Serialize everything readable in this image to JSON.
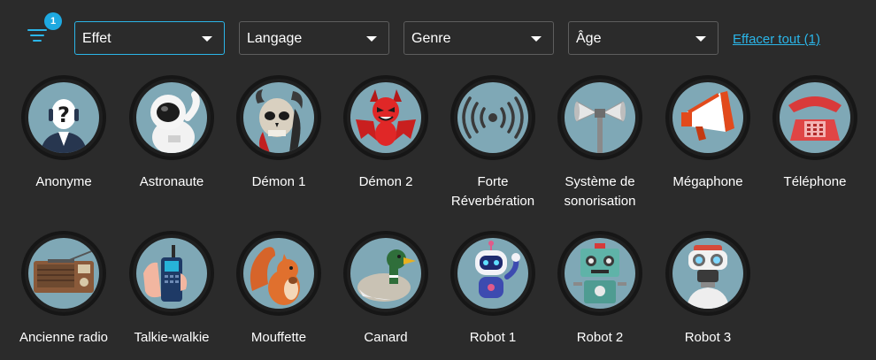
{
  "filters": {
    "badge_count": "1",
    "effect": {
      "value": "Effet"
    },
    "language": {
      "value": "Langage"
    },
    "genre": {
      "value": "Genre"
    },
    "age": {
      "value": "Âge"
    },
    "clear_label": "Effacer tout (1)"
  },
  "effects": [
    {
      "label": "Anonyme",
      "icon": "anonymous-icon"
    },
    {
      "label": "Astronaute",
      "icon": "astronaut-icon"
    },
    {
      "label": "Démon 1",
      "icon": "skull-demon-icon"
    },
    {
      "label": "Démon 2",
      "icon": "red-devil-icon"
    },
    {
      "label": "Forte Réverbération",
      "icon": "reverb-icon"
    },
    {
      "label": "Système de sonorisation",
      "icon": "pa-speaker-icon"
    },
    {
      "label": "Mégaphone",
      "icon": "megaphone-icon"
    },
    {
      "label": "Téléphone",
      "icon": "telephone-icon"
    },
    {
      "label": "Ancienne radio",
      "icon": "old-radio-icon"
    },
    {
      "label": "Talkie-walkie",
      "icon": "walkie-talkie-icon"
    },
    {
      "label": "Mouffette",
      "icon": "squirrel-icon"
    },
    {
      "label": "Canard",
      "icon": "duck-icon"
    },
    {
      "label": "Robot 1",
      "icon": "robot-1-icon"
    },
    {
      "label": "Robot 2",
      "icon": "robot-2-icon"
    },
    {
      "label": "Robot 3",
      "icon": "robot-3-icon"
    }
  ],
  "colors": {
    "background": "#2b2b2b",
    "accent": "#2bb5e8",
    "avatar_bg": "#7fa8b6"
  }
}
